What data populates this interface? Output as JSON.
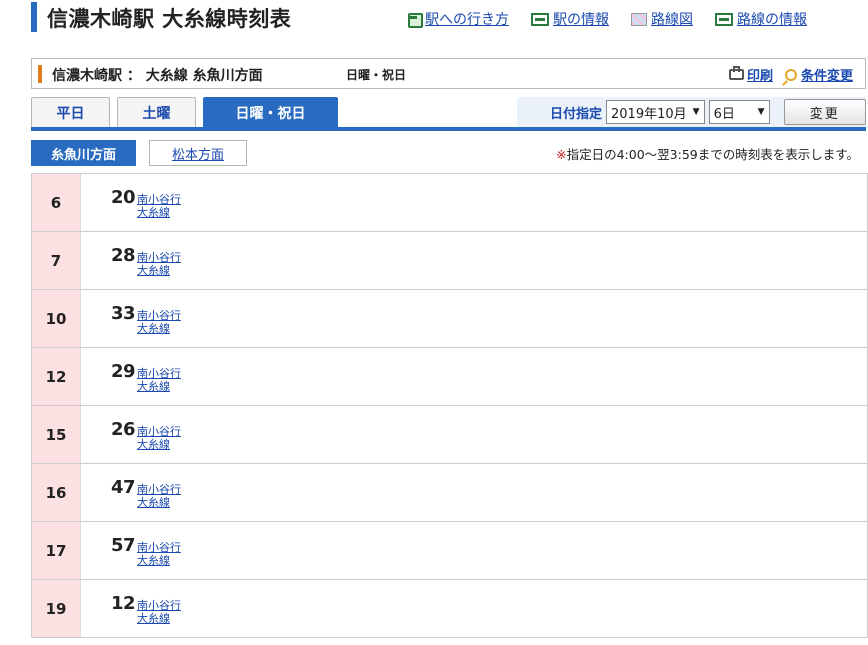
{
  "header": {
    "title": "信濃木崎駅 大糸線時刻表",
    "links": [
      {
        "label": "駅への行き方",
        "icon": "bus-icon"
      },
      {
        "label": "駅の情報",
        "icon": "station-icon"
      },
      {
        "label": "路線図",
        "icon": "map-icon"
      },
      {
        "label": "路線の情報",
        "icon": "station-icon"
      }
    ]
  },
  "subheader": {
    "title": "信濃木崎駅 ： 大糸線 糸魚川方面",
    "day_type": "日曜・祝日",
    "print_label": "印刷",
    "conditions_label": "条件変更"
  },
  "tabs": [
    "平日",
    "土曜",
    "日曜・祝日"
  ],
  "active_tab": "日曜・祝日",
  "date_picker": {
    "label": "日付指定",
    "month": "2019年10月",
    "day": "6日",
    "button": "変更"
  },
  "directions": {
    "active": "糸魚川方面",
    "other": "松本方面",
    "note_mark": "※",
    "note": "指定日の4:00～翌3:59までの時刻表を表示します。"
  },
  "timetable": [
    {
      "hour": "6",
      "minute": "20",
      "destination": "南小谷行",
      "line": "大糸線"
    },
    {
      "hour": "7",
      "minute": "28",
      "destination": "南小谷行",
      "line": "大糸線"
    },
    {
      "hour": "10",
      "minute": "33",
      "destination": "南小谷行",
      "line": "大糸線"
    },
    {
      "hour": "12",
      "minute": "29",
      "destination": "南小谷行",
      "line": "大糸線"
    },
    {
      "hour": "15",
      "minute": "26",
      "destination": "南小谷行",
      "line": "大糸線"
    },
    {
      "hour": "16",
      "minute": "47",
      "destination": "南小谷行",
      "line": "大糸線"
    },
    {
      "hour": "17",
      "minute": "57",
      "destination": "南小谷行",
      "line": "大糸線"
    },
    {
      "hour": "19",
      "minute": "12",
      "destination": "南小谷行",
      "line": "大糸線"
    }
  ],
  "colors": {
    "accent": "#2a6bc2",
    "link": "#1b4ab0",
    "hour_bg": "#fbe1e1",
    "sub_bar": "#e07a1c",
    "note_mark": "#d02020"
  }
}
